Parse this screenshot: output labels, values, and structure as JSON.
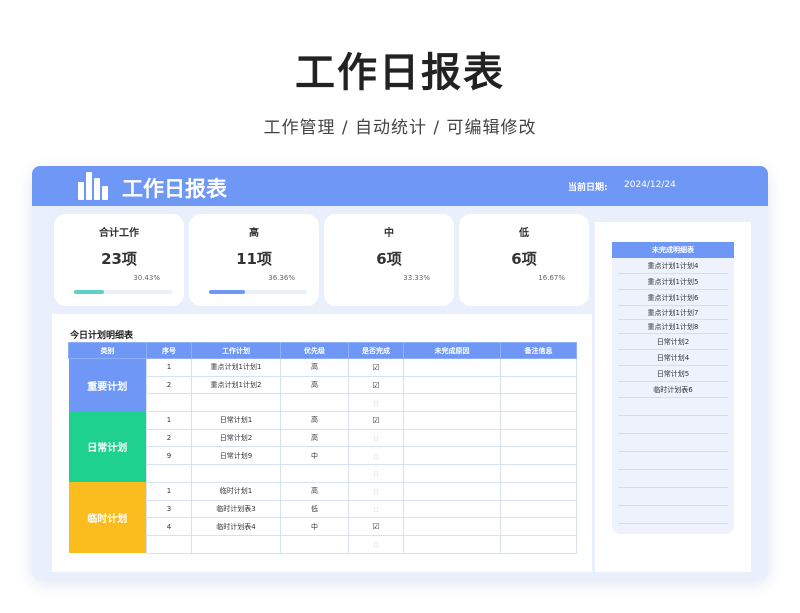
{
  "hero": {
    "title": "工作日报表",
    "subtitle": "工作管理 / 自动统计 / 可编辑修改"
  },
  "header": {
    "app_title": "工作日报表",
    "date_label": "当前日期:",
    "date_value": "2024/12/24"
  },
  "stats": [
    {
      "label": "合计工作",
      "value": "23项",
      "percent": "30.43%",
      "fill": 0.3043,
      "color": "#5fcfcb"
    },
    {
      "label": "高",
      "value": "11项",
      "percent": "36.36%",
      "fill": 0.3636,
      "color": "#6f97f6"
    },
    {
      "label": "中",
      "value": "6项",
      "percent": "33.33%",
      "fill": 0.3333,
      "color": "#f5b942"
    },
    {
      "label": "低",
      "value": "6项",
      "percent": "16.67%",
      "fill": 0.1667,
      "color": "#f08a8a"
    }
  ],
  "table": {
    "title": "今日计划明细表",
    "columns": [
      "类别",
      "序号",
      "工作计划",
      "优先级",
      "是否完成",
      "未完成原因",
      "备注信息"
    ],
    "groups": [
      {
        "category": "重要计划",
        "color": "#6f97f6",
        "rows": [
          {
            "no": "1",
            "plan": "重点计划1计划1",
            "priority": "高",
            "done": "☑",
            "done_flag": true
          },
          {
            "no": "2",
            "plan": "重点计划1计划2",
            "priority": "高",
            "done": "☑",
            "done_flag": true
          },
          {
            "no": "",
            "plan": "",
            "priority": "",
            "done": "□",
            "done_flag": false
          }
        ]
      },
      {
        "category": "日常计划",
        "color": "#1fd18e",
        "rows": [
          {
            "no": "1",
            "plan": "日常计划1",
            "priority": "高",
            "done": "☑",
            "done_flag": true
          },
          {
            "no": "2",
            "plan": "日常计划2",
            "priority": "高",
            "done": "□",
            "done_flag": false
          },
          {
            "no": "9",
            "plan": "日常计划9",
            "priority": "中",
            "done": "□",
            "done_flag": false
          },
          {
            "no": "",
            "plan": "",
            "priority": "",
            "done": "□",
            "done_flag": false
          }
        ]
      },
      {
        "category": "临时计划",
        "color": "#fbbd1d",
        "rows": [
          {
            "no": "1",
            "plan": "临时计划1",
            "priority": "高",
            "done": "□",
            "done_flag": false
          },
          {
            "no": "3",
            "plan": "临时计划表3",
            "priority": "低",
            "done": "□",
            "done_flag": false
          },
          {
            "no": "4",
            "plan": "临时计划表4",
            "priority": "中",
            "done": "☑",
            "done_flag": true
          },
          {
            "no": "",
            "plan": "",
            "priority": "",
            "done": "□",
            "done_flag": false
          }
        ]
      }
    ]
  },
  "sidebar": {
    "title": "未完成明细表",
    "items": [
      "重点计划1计划4",
      "重点计划1计划5",
      "重点计划1计划6",
      "重点计划1计划7",
      "重点计划1计划8",
      "日常计划2",
      "日常计划4",
      "日常计划5",
      "临时计划表6"
    ]
  }
}
